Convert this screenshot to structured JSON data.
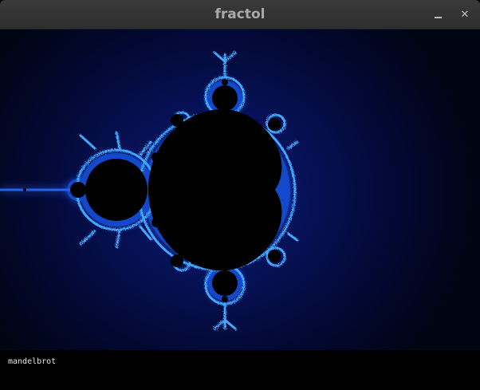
{
  "window": {
    "title": "fractol",
    "minimize_icon": "minimize-icon",
    "close_icon": "close-icon",
    "close_glyph": "✕"
  },
  "canvas": {
    "fractal_name": "mandelbrot",
    "colors": {
      "set": "#000000",
      "edge": "#3fa8ff",
      "glow": "#0a1a78",
      "background": "#000514"
    }
  }
}
